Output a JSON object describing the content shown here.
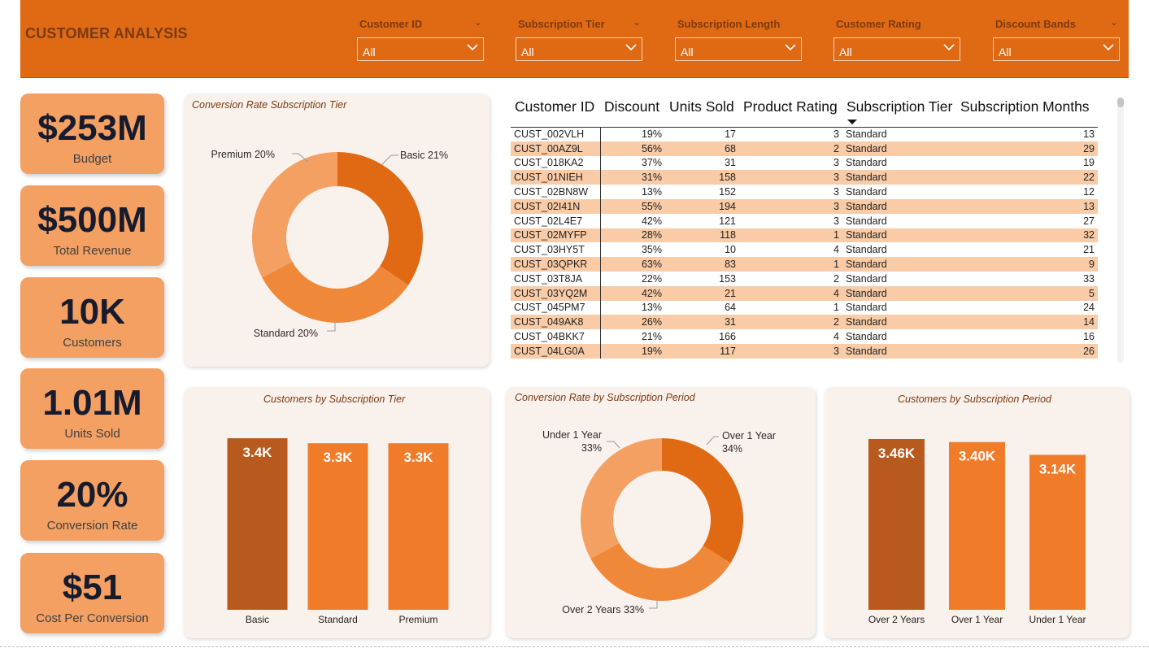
{
  "header": {
    "title": "CUSTOMER ANALYSIS",
    "filters": [
      {
        "label": "Customer ID",
        "value": "All"
      },
      {
        "label": "Subscription Tier",
        "value": "All"
      },
      {
        "label": "Subscription Length",
        "value": "All"
      },
      {
        "label": "Customer Rating",
        "value": "All"
      },
      {
        "label": "Discount Bands",
        "value": "All"
      }
    ]
  },
  "kpis": [
    {
      "value": "$253M",
      "label": "Budget"
    },
    {
      "value": "$500M",
      "label": "Total Revenue"
    },
    {
      "value": "10K",
      "label": "Customers"
    },
    {
      "value": "1.01M",
      "label": "Units Sold"
    },
    {
      "value": "20%",
      "label": "Conversion Rate"
    },
    {
      "value": "$51",
      "label": "Cost Per Conversion"
    }
  ],
  "colors": {
    "header": "#e06a14",
    "kpi": "#f4a062",
    "card": "#f9f1ec",
    "dark_orange": "#b85a1d",
    "orange": "#f07c2a",
    "donut_dark": "#e06a14",
    "donut_mid": "#f0883a",
    "donut_light": "#f4a062",
    "row_alt": "#f9cba6"
  },
  "table": {
    "columns": [
      "Customer ID",
      "Discount",
      "Units Sold",
      "Product Rating",
      "Subscription Tier",
      "Subscription Months"
    ],
    "rows": [
      [
        "CUST_002VLH",
        "19%",
        "17",
        "3",
        "Standard",
        "13"
      ],
      [
        "CUST_00AZ9L",
        "56%",
        "68",
        "2",
        "Standard",
        "29"
      ],
      [
        "CUST_018KA2",
        "37%",
        "31",
        "3",
        "Standard",
        "19"
      ],
      [
        "CUST_01NIEH",
        "31%",
        "158",
        "3",
        "Standard",
        "22"
      ],
      [
        "CUST_02BN8W",
        "13%",
        "152",
        "3",
        "Standard",
        "12"
      ],
      [
        "CUST_02I41N",
        "55%",
        "194",
        "3",
        "Standard",
        "13"
      ],
      [
        "CUST_02L4E7",
        "42%",
        "121",
        "3",
        "Standard",
        "27"
      ],
      [
        "CUST_02MYFP",
        "28%",
        "118",
        "1",
        "Standard",
        "32"
      ],
      [
        "CUST_03HY5T",
        "35%",
        "10",
        "4",
        "Standard",
        "21"
      ],
      [
        "CUST_03QPKR",
        "63%",
        "83",
        "1",
        "Standard",
        "9"
      ],
      [
        "CUST_03T8JA",
        "22%",
        "153",
        "2",
        "Standard",
        "33"
      ],
      [
        "CUST_03YQ2M",
        "42%",
        "21",
        "4",
        "Standard",
        "5"
      ],
      [
        "CUST_045PM7",
        "13%",
        "64",
        "1",
        "Standard",
        "24"
      ],
      [
        "CUST_049AK8",
        "26%",
        "31",
        "2",
        "Standard",
        "14"
      ],
      [
        "CUST_04BKK7",
        "21%",
        "166",
        "4",
        "Standard",
        "16"
      ],
      [
        "CUST_04LG0A",
        "19%",
        "117",
        "3",
        "Standard",
        "26"
      ]
    ]
  },
  "chart_data": [
    {
      "type": "pie",
      "title": "Conversion Rate Subscription Tier",
      "categories": [
        "Basic",
        "Standard",
        "Premium"
      ],
      "values": [
        21,
        20,
        20
      ],
      "labels": [
        "Basic 21%",
        "Standard 20%",
        "Premium 20%"
      ],
      "colors": [
        "#e06a14",
        "#f0883a",
        "#f4a062"
      ]
    },
    {
      "type": "bar",
      "title": "Customers by Subscription Tier",
      "categories": [
        "Basic",
        "Standard",
        "Premium"
      ],
      "values": [
        3400,
        3300,
        3300
      ],
      "data_labels": [
        "3.4K",
        "3.3K",
        "3.3K"
      ],
      "colors": [
        "#b85a1d",
        "#f07c2a",
        "#f07c2a"
      ]
    },
    {
      "type": "pie",
      "title": "Conversion Rate by Subscription Period",
      "categories": [
        "Over 1 Year",
        "Over 2 Years",
        "Under 1 Year"
      ],
      "values": [
        34,
        33,
        33
      ],
      "labels": [
        [
          "Over 1 Year",
          "34%"
        ],
        [
          "Over 2 Years 33%"
        ],
        [
          "Under 1 Year",
          "33%"
        ]
      ],
      "colors": [
        "#e06a14",
        "#f0883a",
        "#f4a062"
      ]
    },
    {
      "type": "bar",
      "title": "Customers by Subscription Period",
      "categories": [
        "Over 2 Years",
        "Over 1 Year",
        "Under 1 Year"
      ],
      "values": [
        3460,
        3400,
        3140
      ],
      "data_labels": [
        "3.46K",
        "3.40K",
        "3.14K"
      ],
      "colors": [
        "#b85a1d",
        "#f07c2a",
        "#f07c2a"
      ]
    }
  ]
}
